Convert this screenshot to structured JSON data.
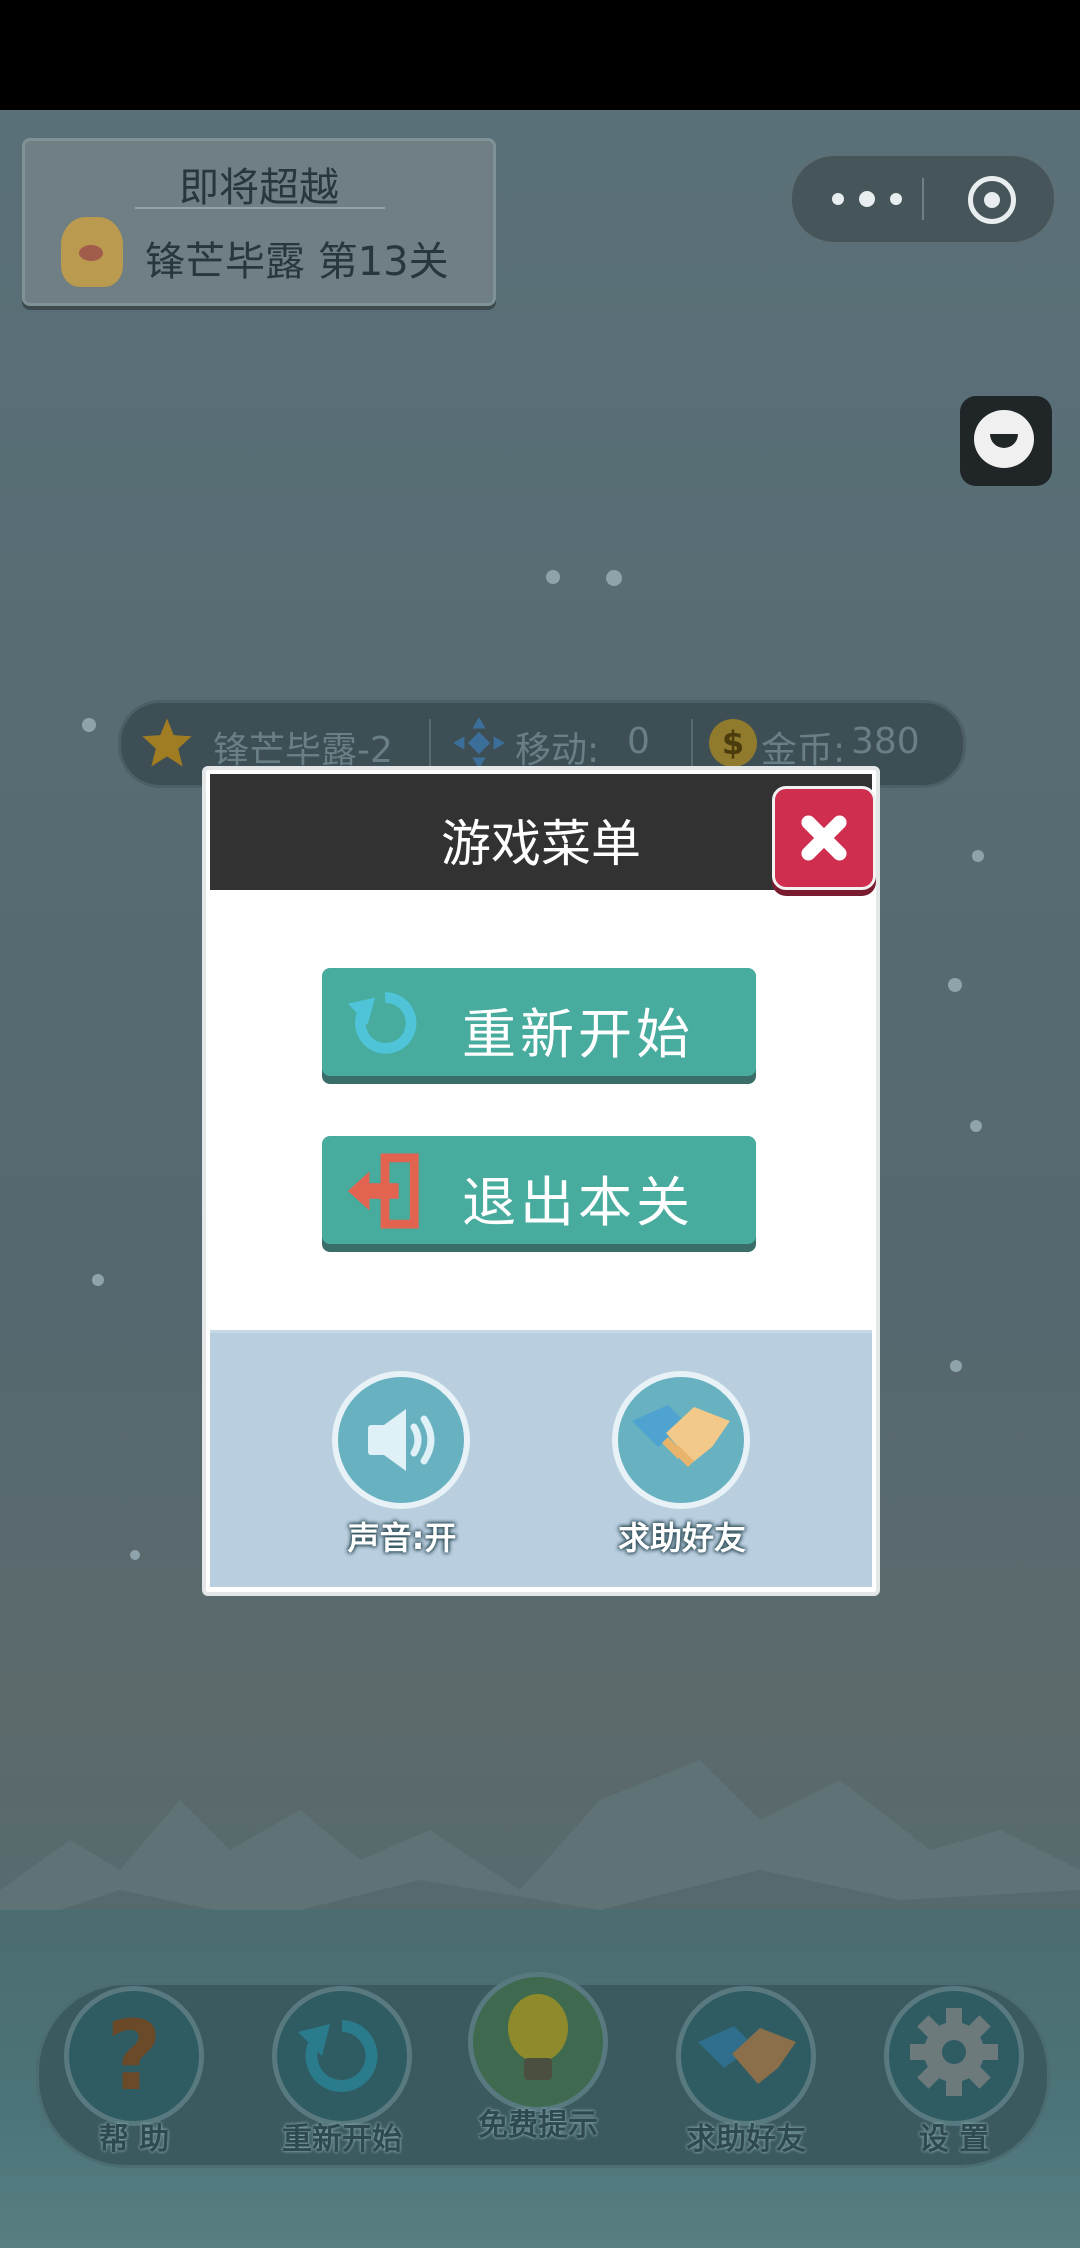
{
  "rank_card": {
    "title": "即将超越",
    "name": "锋芒毕露 第13关"
  },
  "hud": {
    "level": "锋芒毕露-2",
    "moves_label": "移动:",
    "moves_value": "0",
    "coins_label": "金币:",
    "coins_value": "380",
    "coin_symbol": "$"
  },
  "modal": {
    "title": "游戏菜单",
    "restart_label": "重新开始",
    "exit_label": "退出本关",
    "sound_label": "声音:开",
    "help_friend_label": "求助好友"
  },
  "toolbar": {
    "help": "帮 助",
    "restart": "重新开始",
    "hint": "免费提示",
    "ask_friend": "求助好友",
    "settings": "设 置",
    "help_glyph": "?"
  },
  "colors": {
    "teal_button": "#47ab9d",
    "close_red": "#cf2e4e",
    "header_dark": "#323232",
    "footer_blue": "#b9cedf"
  }
}
